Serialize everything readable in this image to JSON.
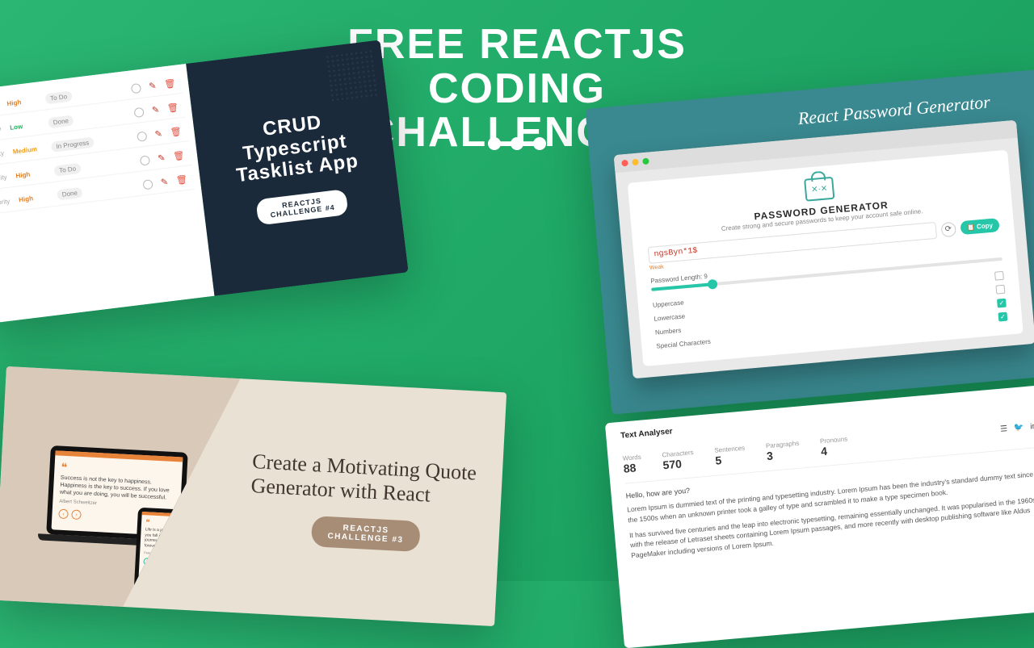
{
  "title_line1": "FREE REACTJS CODING",
  "title_line2": "CHALLENGES",
  "crud": {
    "title": "CRUD\nTypescript\nTasklist App",
    "badge": "REACTJS\nCHALLENGE #4",
    "header_priority": "Priority",
    "rows": [
      {
        "priority": "High",
        "pclass": "p-high",
        "status": "To Do"
      },
      {
        "priority": "Low",
        "pclass": "p-low",
        "status": "Done"
      },
      {
        "priority": "Medium",
        "pclass": "p-med",
        "status": "In Progress"
      },
      {
        "priority": "High",
        "pclass": "p-high",
        "status": "To Do"
      },
      {
        "priority": "High",
        "pclass": "p-high",
        "status": "Done"
      }
    ]
  },
  "pw": {
    "header": "React Password Generator",
    "title": "PASSWORD GENERATOR",
    "subtitle": "Create strong and secure passwords to keep your account safe online.",
    "value": "ngsByn*1$",
    "strength": "Weak",
    "copy": "Copy",
    "length_label": "Password Length: 9",
    "opts": [
      {
        "label": "Uppercase",
        "on": false
      },
      {
        "label": "Lowercase",
        "on": false
      },
      {
        "label": "Numbers",
        "on": true
      },
      {
        "label": "Special Characters",
        "on": true
      }
    ]
  },
  "quote": {
    "title": "Create a Motivating Quote Generator with React",
    "badge": "REACTJS\nCHALLENGE #3",
    "sample1": "Success is not the key to happiness. Happiness is the key to success. If you love what you are doing, you will be successful.",
    "author1": "Albert Schweitzer",
    "sample2": "Life is a journey, and if you fall in love with the journey, you will be in love forever.",
    "author2": "Peter Hagerty"
  },
  "ta": {
    "brand": "Text Analyser",
    "greeting": "Hello, how are you?",
    "stats": [
      {
        "label": "Words",
        "value": "88"
      },
      {
        "label": "Characters",
        "value": "570"
      },
      {
        "label": "Sentences",
        "value": "5"
      },
      {
        "label": "Paragraphs",
        "value": "3"
      },
      {
        "label": "Pronouns",
        "value": "4"
      }
    ],
    "para1": "Lorem Ipsum is dummied text of the printing and typesetting industry. Lorem Ipsum has been the industry's standard dummy text since the 1500s when an unknown printer took a galley of type and scrambled it to make a type specimen book.",
    "para2": "It has survived five centuries and the leap into electronic typesetting, remaining essentially unchanged. It was popularised in the 1960s with the release of Letraset sheets containing Lorem Ipsum passages, and more recently with desktop publishing software like Aldus PageMaker including versions of Lorem Ipsum."
  }
}
